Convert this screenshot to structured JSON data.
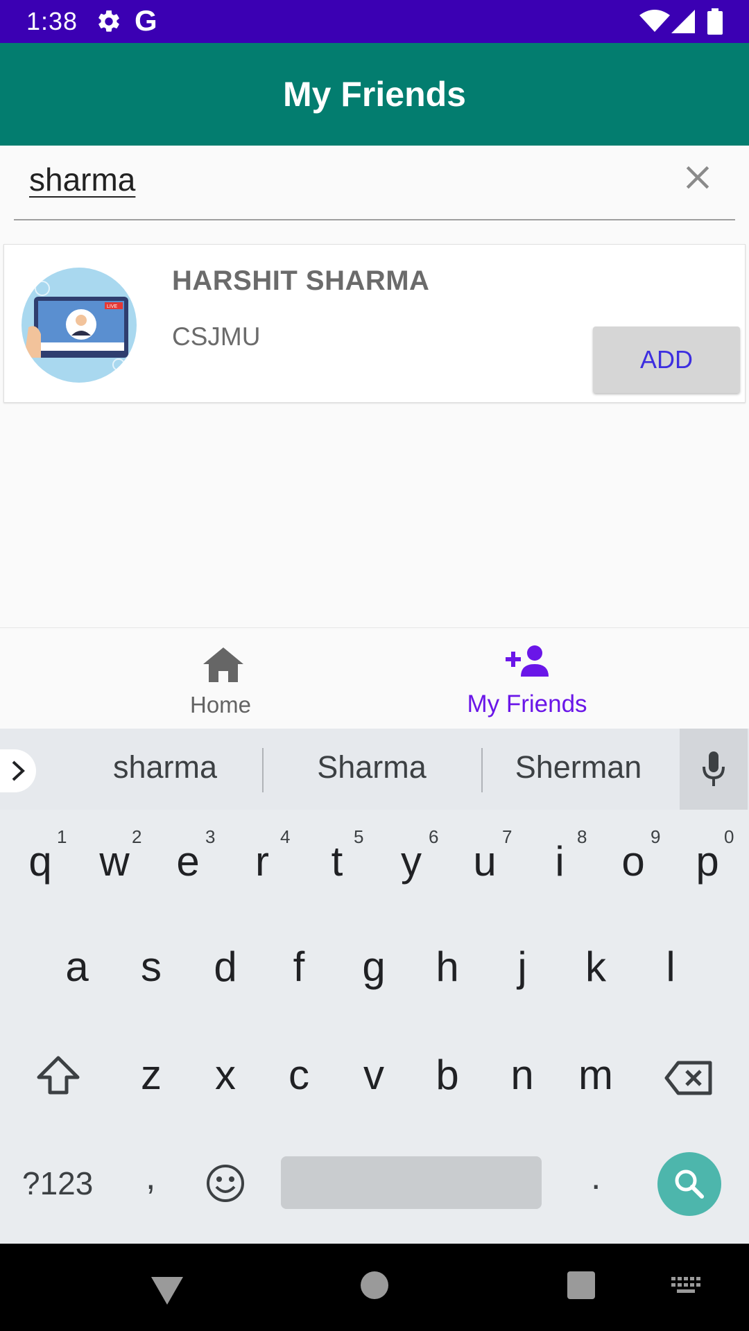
{
  "status_bar": {
    "time": "1:38",
    "icons": [
      "gear-icon",
      "google-g-icon",
      "wifi-icon",
      "signal-icon",
      "battery-icon"
    ],
    "g_letter": "G",
    "color": "#3b00b3"
  },
  "app_bar": {
    "title": "My Friends",
    "color": "#037d6f"
  },
  "search": {
    "value": "sharma",
    "clear_icon": "close-icon"
  },
  "results": [
    {
      "name": "HARSHIT SHARMA",
      "org": "CSJMU",
      "action": "ADD",
      "avatar_badge": "LIVE"
    }
  ],
  "bottom_nav": {
    "items": [
      {
        "label": "Home",
        "icon": "home-icon",
        "active": false
      },
      {
        "label": "My Friends",
        "icon": "person-add-icon",
        "active": true
      }
    ],
    "active_color": "#6a16e8"
  },
  "keyboard": {
    "suggestions": [
      "sharma",
      "Sharma",
      "Sherman"
    ],
    "row1": [
      "q",
      "w",
      "e",
      "r",
      "t",
      "y",
      "u",
      "i",
      "o",
      "p"
    ],
    "row1_hints": [
      "1",
      "2",
      "3",
      "4",
      "5",
      "6",
      "7",
      "8",
      "9",
      "0"
    ],
    "row2": [
      "a",
      "s",
      "d",
      "f",
      "g",
      "h",
      "j",
      "k",
      "l"
    ],
    "row3": [
      "z",
      "x",
      "c",
      "v",
      "b",
      "n",
      "m"
    ],
    "symbols_label": "?123",
    "comma": ",",
    "period": ".",
    "action_color": "#4db6ac"
  }
}
